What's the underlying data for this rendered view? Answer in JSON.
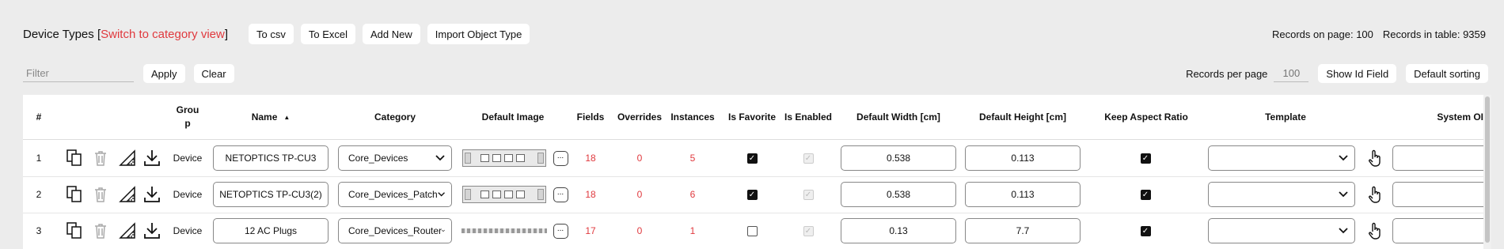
{
  "header": {
    "title": "Device Types",
    "bracket_open": "[",
    "switch_link": "Switch to category view",
    "bracket_close": "]",
    "buttons": [
      "To csv",
      "To Excel",
      "Add New",
      "Import Object Type"
    ],
    "records_on_page": "Records on page: 100",
    "records_in_table": "Records in table: 9359"
  },
  "filter": {
    "placeholder": "Filter",
    "apply_label": "Apply",
    "clear_label": "Clear",
    "records_per_page_label": "Records per page",
    "records_per_page_placeholder": "100",
    "show_id_label": "Show Id Field",
    "default_sorting_label": "Default sorting"
  },
  "table": {
    "columns": {
      "num": "#",
      "group": "Grou\np",
      "name": "Name",
      "sort_indicator": "▲",
      "category": "Category",
      "default_image": "Default Image",
      "fields": "Fields",
      "overrides": "Overrides",
      "instances": "Instances",
      "is_favorite": "Is Favorite",
      "is_enabled": "Is Enabled",
      "default_width": "Default Width [cm]",
      "default_height": "Default Height [cm]",
      "keep_aspect_ratio": "Keep Aspect Ratio",
      "template": "Template",
      "system_oid": "System OID"
    },
    "rows": [
      {
        "num": "1",
        "group": "Device",
        "name": "NETOPTICS TP-CU3",
        "category": "Core_Devices",
        "image": "device",
        "fields": "18",
        "overrides": "0",
        "instances": "5",
        "favorite": true,
        "enabled": true,
        "width": "0.538",
        "height": "0.113",
        "keep_aspect": true,
        "template": ""
      },
      {
        "num": "2",
        "group": "Device",
        "name": "NETOPTICS TP-CU3(2)",
        "category": "Core_Devices_Patch",
        "image": "device",
        "fields": "18",
        "overrides": "0",
        "instances": "6",
        "favorite": true,
        "enabled": true,
        "width": "0.538",
        "height": "0.113",
        "keep_aspect": true,
        "template": ""
      },
      {
        "num": "3",
        "group": "Device",
        "name": "12 AC Plugs",
        "category": "Core_Devices_Router",
        "image": "plugs",
        "fields": "17",
        "overrides": "0",
        "instances": "1",
        "favorite": false,
        "enabled": true,
        "width": "0.13",
        "height": "7.7",
        "keep_aspect": true,
        "template": ""
      }
    ],
    "more_button": "..."
  },
  "icons": {
    "copy": "copy-icon",
    "delete": "trash-icon",
    "dimensions": "ruler-triangle-icon",
    "download": "download-icon",
    "template_picker": "pointer-hand-icon",
    "select_arrow": "chevron-down-icon"
  },
  "colors": {
    "accent_red": "#e0393e",
    "page_bg": "#ececec"
  }
}
